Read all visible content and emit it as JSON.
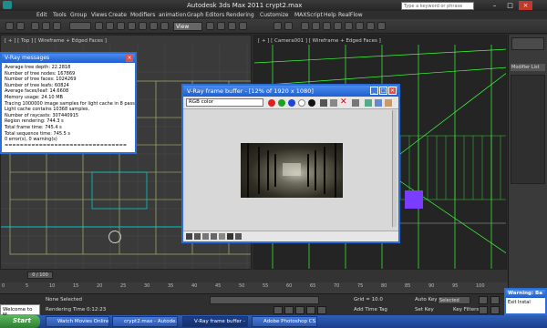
{
  "window": {
    "title": "Autodesk 3ds Max  2011       crypt2.max",
    "search_placeholder": "Type a keyword or phrase"
  },
  "menu": [
    "Edit",
    "Tools",
    "Group",
    "Views",
    "Create",
    "Modifiers",
    "animation",
    "Graph Editors",
    "Rendering",
    "Customize",
    "MAXScript",
    "Help",
    "RealFlow"
  ],
  "toolbar": {
    "view_dropdown": "View"
  },
  "viewports": {
    "left_label": "[ + ] [ Top ] [ Wireframe + Edged Faces ]",
    "right_label": "[ + ] [ Camera001 ] [ Wireframe + Edged Faces ]"
  },
  "command_panel": {
    "modifier_list": "Modifier List"
  },
  "vray_messages": {
    "title": "V-Ray messages",
    "lines": [
      "Average tree depth: 22.2818",
      "Number of tree nodes: 167869",
      "Number of tree faces: 1024269",
      "Number of tree leafs: 60824",
      "Average faces/leaf: 14.6608",
      "Memory usage: 24.10 MB",
      "Tracing 1000000 image samples for light cache in 8 passes",
      "Light cache contains 10368 samples.",
      "Number of raycasts: 307440915",
      "Region rendering: 744.3 s",
      "Total frame time: 745.4 s",
      "Total sequence time: 745.5 s",
      "0 error(s), 0 warning(s)",
      "================================"
    ]
  },
  "vray_fb": {
    "title": "V-Ray frame buffer - [12% of 1920 x 1080]",
    "channel": "RGB color"
  },
  "timeline": {
    "frame": "0 / 100",
    "ticks": [
      "0",
      "5",
      "10",
      "15",
      "20",
      "25",
      "30",
      "35",
      "40",
      "45",
      "50",
      "55",
      "60",
      "65",
      "70",
      "75",
      "80",
      "85",
      "90",
      "95",
      "100"
    ]
  },
  "status": {
    "selection": "None Selected",
    "rendering_time": "Rendering Time  0:12:23",
    "grid": "Grid = 10.0",
    "autokey": "Auto Key",
    "selected_dd": "Selected",
    "setkey": "Set Key",
    "key_filters": "Key Filters...",
    "add_time_tag": "Add Time Tag",
    "welcome": "Welcome to M"
  },
  "warning": {
    "title": "Warning: Ba",
    "text": "Exit Instal"
  },
  "taskbar": {
    "start": "Start",
    "tasks": [
      "Watch Movies Online ...",
      "crypt2.max - Autode...",
      "V-Ray frame buffer - ...",
      "Adobe Photoshop CS..."
    ]
  },
  "colors": {
    "accent": "#2a6fd6",
    "select_green": "#3cff3c",
    "cyan": "#00d8d8"
  }
}
